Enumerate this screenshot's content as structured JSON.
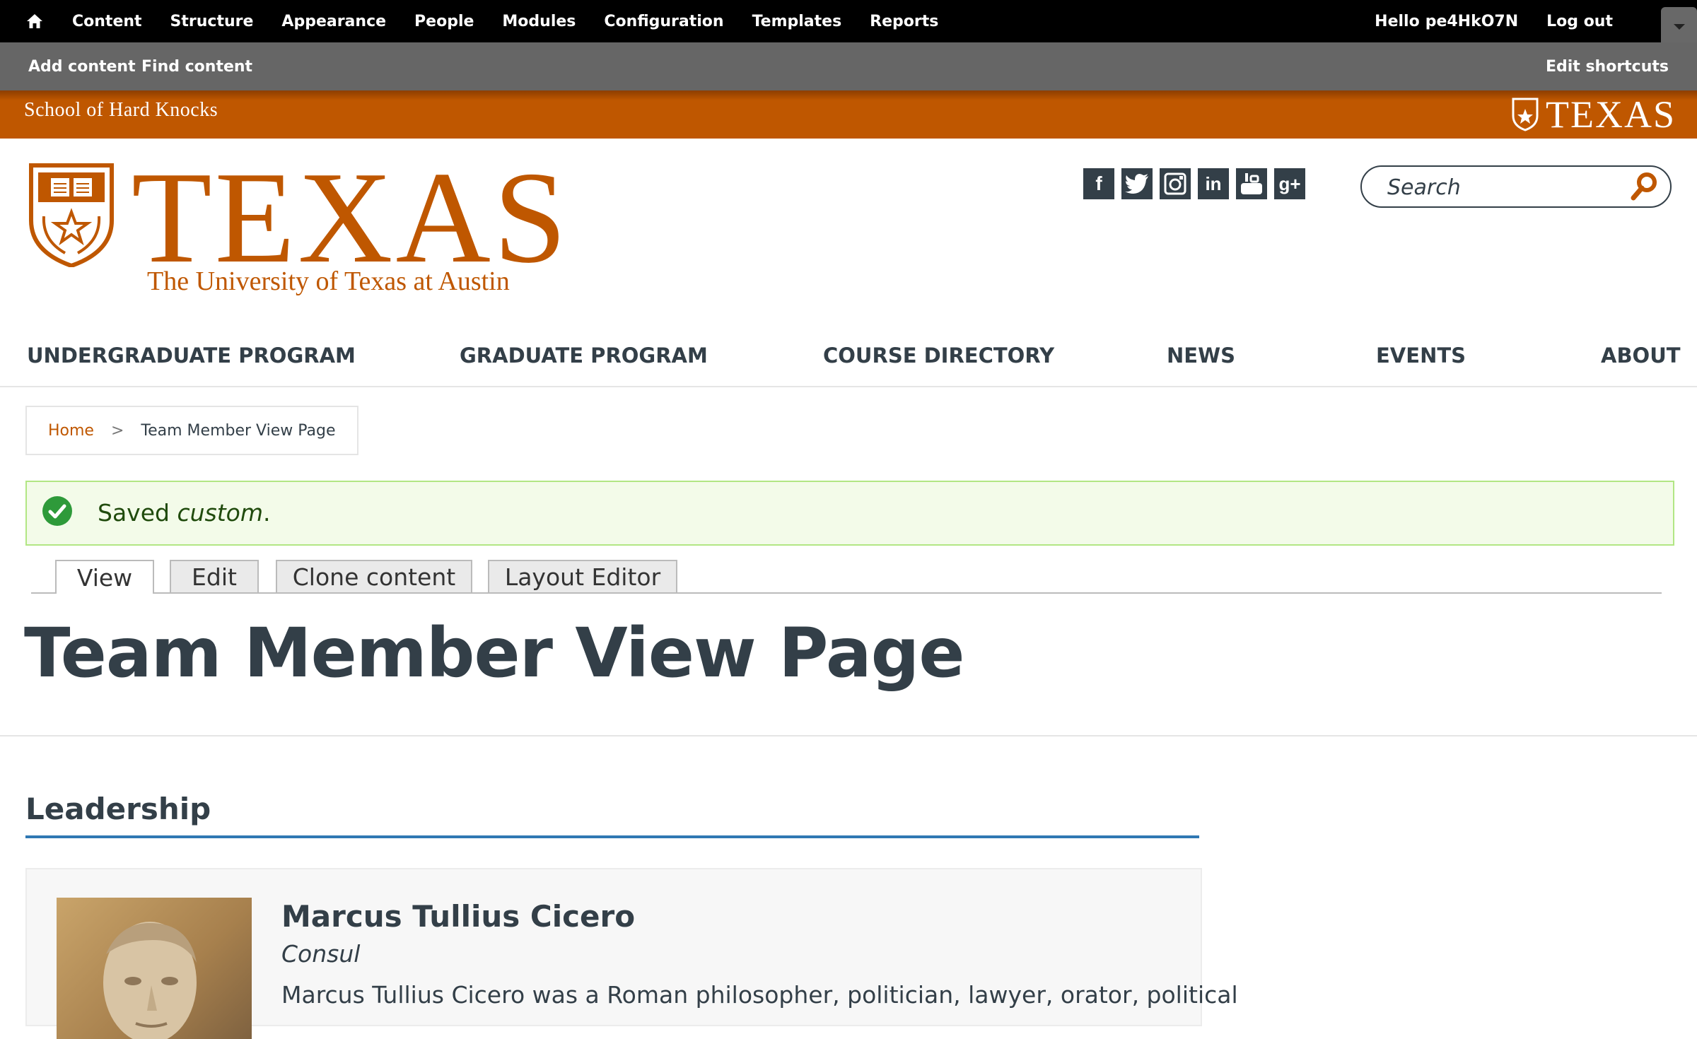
{
  "admin_toolbar": {
    "menu": [
      "Content",
      "Structure",
      "Appearance",
      "People",
      "Modules",
      "Configuration",
      "Templates",
      "Reports"
    ],
    "hello_label": "Hello",
    "username": "pe4HkO7N",
    "logout": "Log out"
  },
  "shortcuts": {
    "add_content": "Add content",
    "find_content": "Find content",
    "edit_shortcuts": "Edit shortcuts"
  },
  "parent_bar": {
    "site_name": "School of Hard Knocks",
    "brand_word": "TEXAS"
  },
  "brand": {
    "wordmark": "TEXAS",
    "subtitle": "The University of Texas at Austin"
  },
  "social_icons": [
    "facebook-icon",
    "twitter-icon",
    "instagram-icon",
    "linkedin-icon",
    "youtube-icon",
    "google-plus-icon"
  ],
  "search": {
    "placeholder": "Search"
  },
  "main_nav": [
    "UNDERGRADUATE PROGRAM",
    "GRADUATE PROGRAM",
    "COURSE DIRECTORY",
    "NEWS",
    "EVENTS",
    "ABOUT"
  ],
  "breadcrumb": {
    "home": "Home",
    "separator": ">",
    "current": "Team Member View Page"
  },
  "status": {
    "prefix": "Saved ",
    "item": "custom",
    "suffix": "."
  },
  "tabs": [
    "View",
    "Edit",
    "Clone content",
    "Layout Editor"
  ],
  "page_title": "Team Member View Page",
  "section": {
    "heading": "Leadership",
    "member": {
      "name": "Marcus Tullius Cicero",
      "role": "Consul",
      "bio": "Marcus Tullius Cicero was a Roman philosopher, politician, lawyer, orator, political"
    }
  },
  "colors": {
    "burnt_orange": "#bf5700",
    "charcoal": "#333f48",
    "status_green": "#2e9a3a",
    "link_blue": "#2f78b3"
  }
}
